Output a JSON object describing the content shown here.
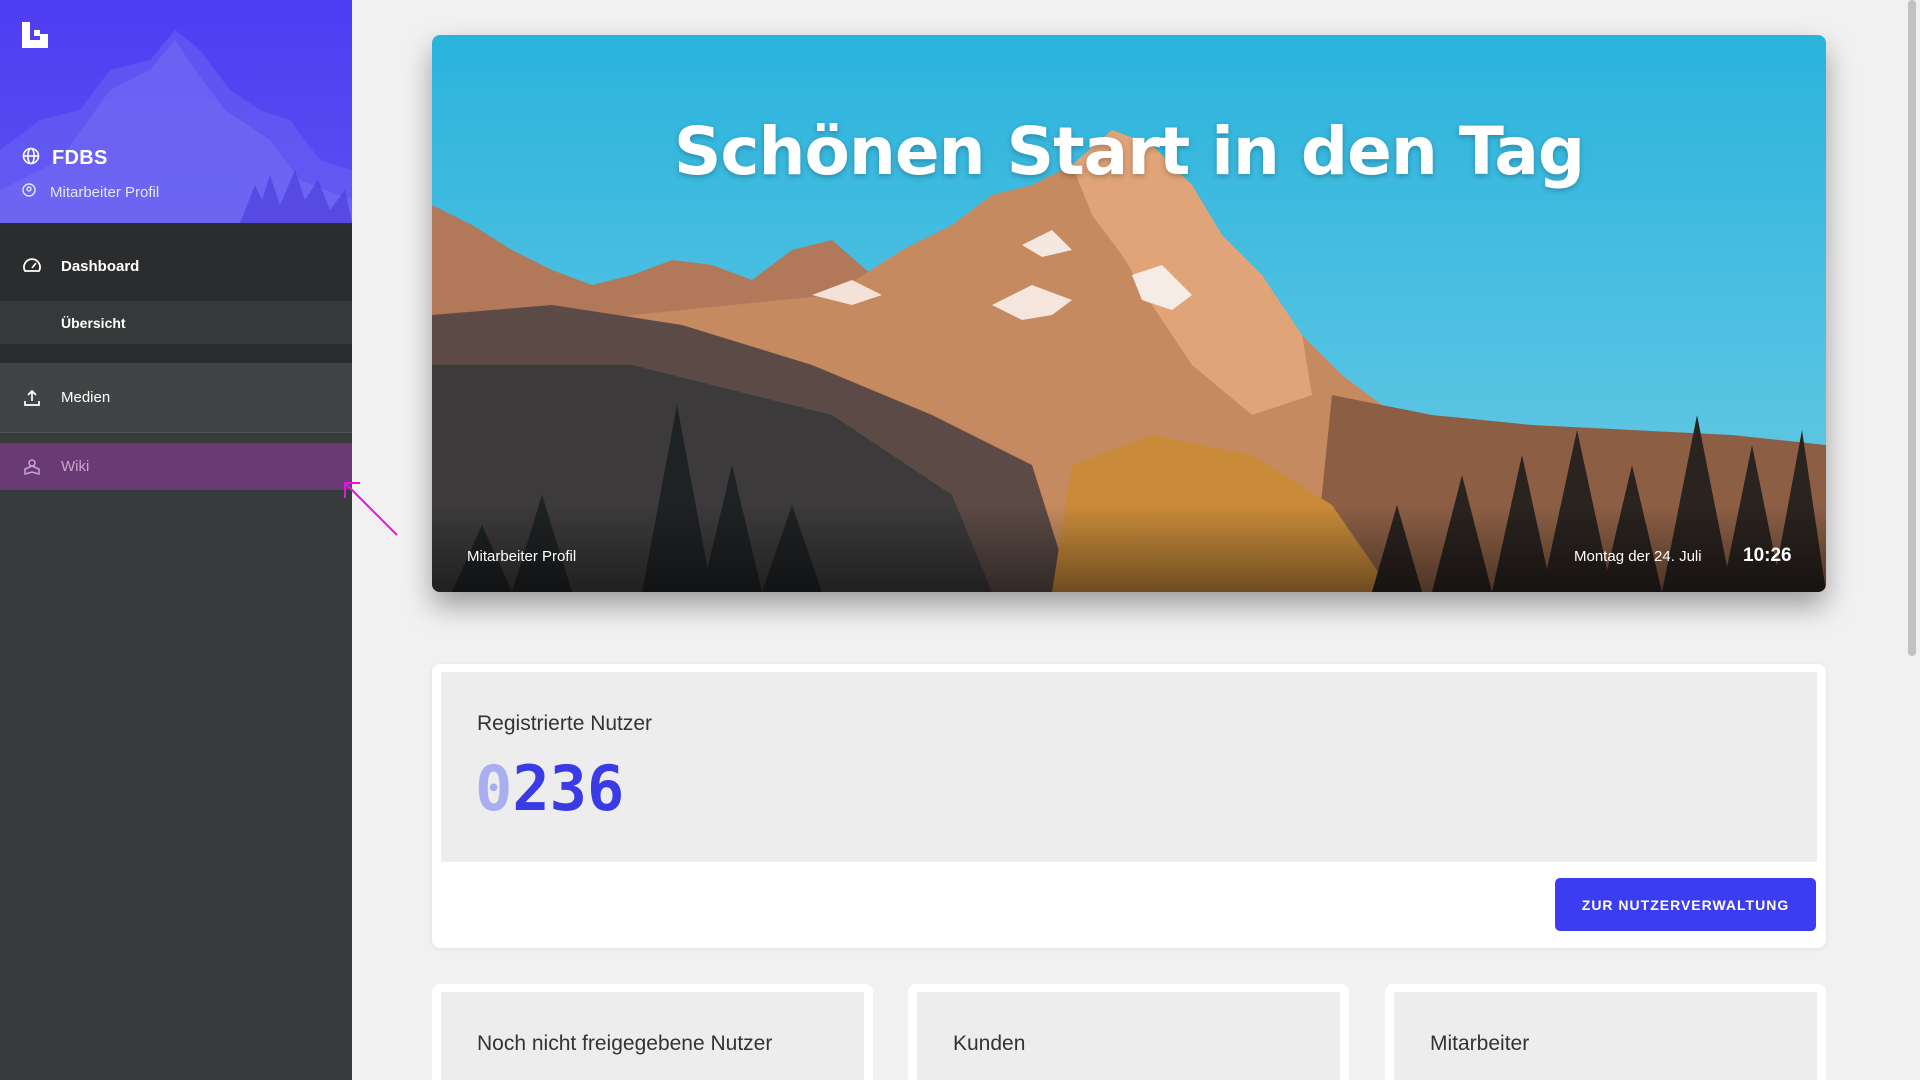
{
  "sidebar": {
    "brand": "FDBS",
    "profile_link": "Mitarbeiter Profil",
    "items": [
      {
        "label": "Dashboard",
        "icon": "dashboard-icon"
      },
      {
        "label": "Übersicht"
      },
      {
        "label": "Medien",
        "icon": "upload-icon"
      },
      {
        "label": "Wiki",
        "icon": "wiki-icon"
      }
    ],
    "header_color": "#4e3df2",
    "active_color": "#6a3a74"
  },
  "hero": {
    "title": "Schönen Start in den Tag",
    "left_caption": "Mitarbeiter Profil",
    "date": "Montag der 24. Juli",
    "time": "10:26"
  },
  "stats": {
    "registered": {
      "title": "Registrierte Nutzer",
      "count_pad": "0",
      "count": "236",
      "button_label": "ZUR NUTZERVERWALTUNG"
    },
    "cards": [
      {
        "title": "Noch nicht freigegebene Nutzer"
      },
      {
        "title": "Kunden"
      },
      {
        "title": "Mitarbeiter"
      }
    ]
  },
  "accent_color": "#3c3cf0"
}
